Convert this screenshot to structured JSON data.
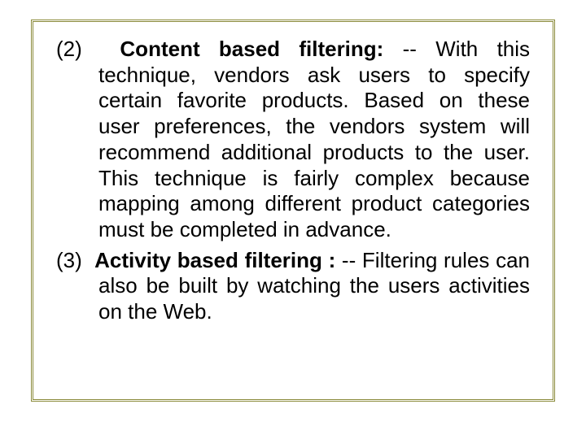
{
  "items": [
    {
      "number": "(2)",
      "title": "Content based filtering:",
      "sep": " --  ",
      "body": "With this technique, vendors ask users to specify certain favorite products. Based on these user preferences, the vendors system will recommend additional products to the user. This technique is fairly complex because mapping among different product categories must be completed in advance."
    },
    {
      "number": "(3)",
      "title": "Activity based filtering :",
      "sep": " -- ",
      "body": "Filtering rules can also be built by watching the users activities on the Web."
    }
  ]
}
